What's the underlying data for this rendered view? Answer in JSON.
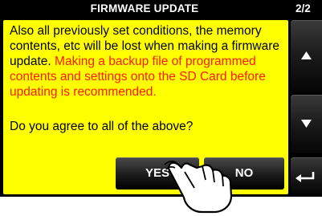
{
  "header": {
    "title": "FIRMWARE UPDATE",
    "page_indicator": "2/2"
  },
  "dialog": {
    "message_normal": "Also all previously set conditions, the memory contents, etc will be lost when making a firmware update. ",
    "message_warning": "Making a backup file of programmed contents and settings onto the SD Card before updating is recommended.",
    "question": "Do you agree to all of the above?",
    "yes_label": "YES",
    "no_label": "NO"
  },
  "side_buttons": {
    "up_icon": "up-arrow-icon",
    "down_icon": "down-arrow-icon",
    "back_icon": "return-arrow-icon"
  },
  "colors": {
    "panel_background": "#ffff00",
    "warning_text": "#ff1a00",
    "screen_background": "#000000"
  }
}
